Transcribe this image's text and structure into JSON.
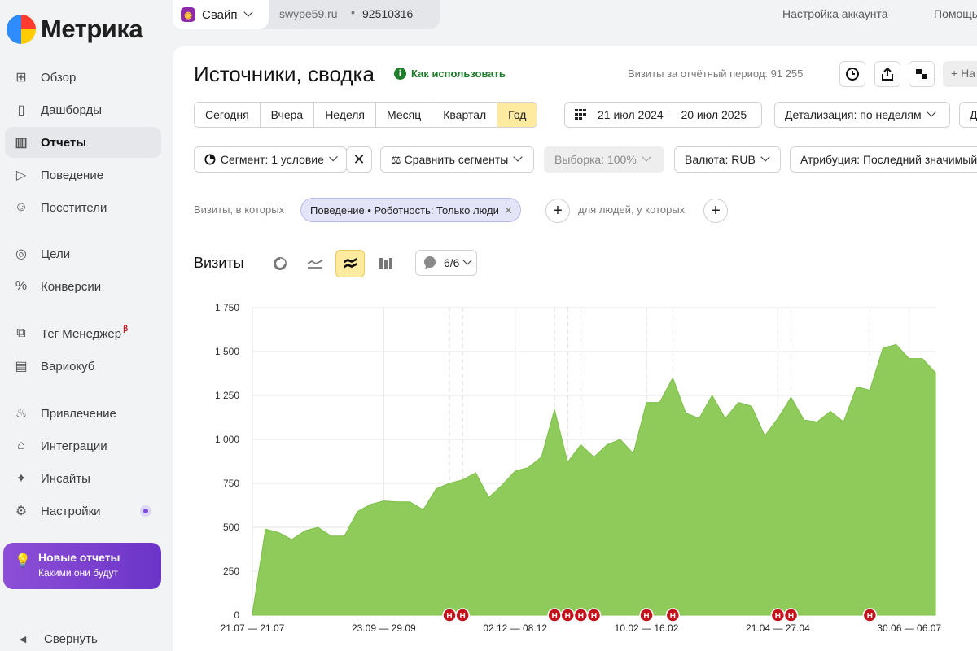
{
  "app": {
    "logo_text": "Метрика"
  },
  "counter": {
    "app_name": "Свайп",
    "domain": "swype59.ru",
    "separator": "•",
    "id": "92510316"
  },
  "top_links": {
    "account_settings": "Настройка аккаунта",
    "help": "Помощь"
  },
  "sidebar": {
    "items": [
      {
        "label": "Обзор",
        "icon": "grid-icon",
        "active": false
      },
      {
        "label": "Дашборды",
        "icon": "dashboards-icon",
        "active": false
      },
      {
        "label": "Отчеты",
        "icon": "bar-chart-icon",
        "active": true
      },
      {
        "label": "Поведение",
        "icon": "play-icon",
        "active": false
      },
      {
        "label": "Посетители",
        "icon": "person-icon",
        "active": false
      },
      {
        "label": "Цели",
        "icon": "target-icon",
        "active": false
      },
      {
        "label": "Конверсии",
        "icon": "percent-icon",
        "active": false
      },
      {
        "label": "Тег Менеджер",
        "icon": "tag-manager-icon",
        "active": false,
        "badge": "β"
      },
      {
        "label": "Вариокуб",
        "icon": "variocube-icon",
        "active": false
      },
      {
        "label": "Привлечение",
        "icon": "flame-icon",
        "active": false
      },
      {
        "label": "Интеграции",
        "icon": "puzzle-icon",
        "active": false
      },
      {
        "label": "Инсайты",
        "icon": "sparkle-icon",
        "active": false
      },
      {
        "label": "Настройки",
        "icon": "gear-icon",
        "active": false
      }
    ],
    "promo": {
      "title": "Новые отчеты",
      "subtitle": "Какими они будут"
    },
    "collapse_label": "Свернуть"
  },
  "page": {
    "title": "Источники, сводка",
    "how_to_use": "Как использовать",
    "visits_total": "Визиты за отчётный период: 91 255",
    "add_label": "+ На"
  },
  "period": {
    "options": [
      "Сегодня",
      "Вчера",
      "Неделя",
      "Месяц",
      "Квартал",
      "Год"
    ],
    "active": "Год",
    "date_range": "21 июл 2024 — 20 июл 2025",
    "detail": "Детализация: по неделям",
    "extra": "Д"
  },
  "filters": {
    "segment": "Сегмент: 1 условие",
    "compare": "Сравнить сегменты",
    "sample": "Выборка: 100%",
    "currency": "Валюта: RUB",
    "attribution": "Атрибуция: Последний значимый"
  },
  "conditions": {
    "prefix": "Визиты, в которых",
    "chip": "Поведение • Роботность: Только люди",
    "people_label": "для людей, у которых"
  },
  "chart_header": {
    "title": "Визиты",
    "notes_label": "6/6"
  },
  "chart_data": {
    "type": "area",
    "color": "#8ecb5b",
    "ylim": [
      0,
      1750
    ],
    "yticks": [
      "0",
      "250",
      "500",
      "750",
      "1 000",
      "1 250",
      "1 500",
      "1 750"
    ],
    "ytick_values": [
      0,
      250,
      500,
      750,
      1000,
      1250,
      1500,
      1750
    ],
    "xtick_labels": [
      "21.07 — 21.07",
      "23.09 — 29.09",
      "02.12 — 08.12",
      "10.02 — 16.02",
      "21.04 — 27.04",
      "30.06 — 06.07"
    ],
    "xtick_index": [
      0,
      10,
      20,
      30,
      40,
      50
    ],
    "series": [
      {
        "values": [
          10,
          490,
          470,
          430,
          480,
          500,
          450,
          450,
          590,
          630,
          650,
          645,
          645,
          600,
          720,
          750,
          770,
          810,
          670,
          740,
          820,
          840,
          900,
          1170,
          870,
          970,
          900,
          970,
          1000,
          920,
          1210,
          1210,
          1350,
          1150,
          1120,
          1250,
          1120,
          1210,
          1190,
          1020,
          1120,
          1240,
          1110,
          1100,
          1160,
          1100,
          1300,
          1280,
          1520,
          1540,
          1460,
          1460,
          1380
        ]
      }
    ],
    "annotation_label": "Н",
    "annotation_weeks": [
      15,
      16,
      23,
      24,
      25,
      26,
      30,
      32,
      40,
      41,
      47
    ],
    "marker_lines": [
      15,
      16,
      23,
      24,
      25,
      30,
      32,
      40,
      41,
      47
    ]
  }
}
